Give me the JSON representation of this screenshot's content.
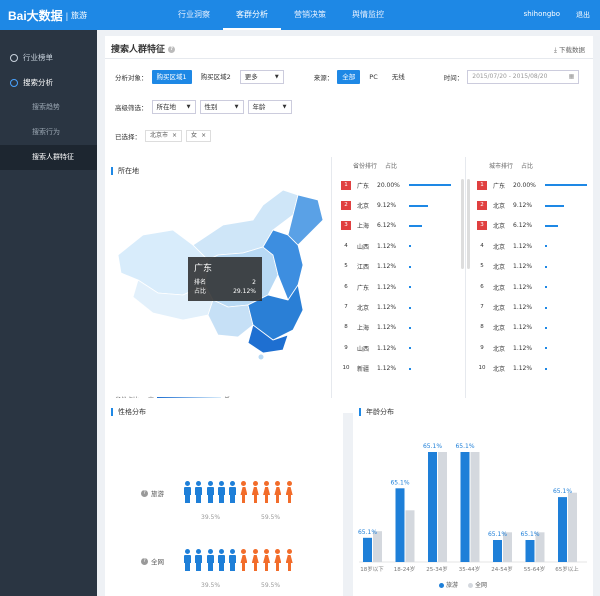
{
  "topbar": {
    "logo_text": "Bai大数据",
    "logo_sep": "|",
    "logo_sub": "旅游",
    "nav": [
      "行业洞察",
      "客群分析",
      "营销决策",
      "舆情监控"
    ],
    "active_nav": 1,
    "user": "shihongbo",
    "logout": "退出"
  },
  "sidebar": {
    "items": [
      {
        "label": "行业榜单",
        "icon": "medal-icon"
      },
      {
        "label": "搜索分析",
        "icon": "search-circle-icon"
      }
    ],
    "subitems": [
      "搜索趋势",
      "搜索行为",
      "搜索人群特征"
    ]
  },
  "header": {
    "title": "搜索人群特征",
    "help": "?",
    "download": "下载数据",
    "filters": {
      "target_label": "分析对象：",
      "target_options": [
        "购买区域1",
        "购买区域2"
      ],
      "more": "更多",
      "source_label": "来源：",
      "source_options": [
        "全部",
        "PC",
        "无线"
      ],
      "time_label": "时间：",
      "time_value": "2015/07/20 - 2015/08/20",
      "adv_label": "高级筛选：",
      "adv_selects": [
        "所在地",
        "性别",
        "年龄"
      ],
      "selected_label": "已选择：",
      "selected_tags": [
        "北京市",
        "女"
      ],
      "tag_close": "×"
    }
  },
  "location": {
    "title": "所在地",
    "province_header": [
      "省份排行",
      "占比"
    ],
    "city_header": [
      "城市排行",
      "占比"
    ],
    "provinces": [
      {
        "rank": "1",
        "name": "广东",
        "pct": "20.00%",
        "value": 20.0
      },
      {
        "rank": "2",
        "name": "北京",
        "pct": "9.12%",
        "value": 9.12
      },
      {
        "rank": "3",
        "name": "上海",
        "pct": "6.12%",
        "value": 6.12
      },
      {
        "rank": "4",
        "name": "山西",
        "pct": "1.12%",
        "value": 1.12
      },
      {
        "rank": "5",
        "name": "江西",
        "pct": "1.12%",
        "value": 1.12
      },
      {
        "rank": "6",
        "name": "广东",
        "pct": "1.12%",
        "value": 1.12
      },
      {
        "rank": "7",
        "name": "北京",
        "pct": "1.12%",
        "value": 1.12
      },
      {
        "rank": "8",
        "name": "上海",
        "pct": "1.12%",
        "value": 1.12
      },
      {
        "rank": "9",
        "name": "山西",
        "pct": "1.12%",
        "value": 1.12
      },
      {
        "rank": "10",
        "name": "新疆",
        "pct": "1.12%",
        "value": 1.12
      }
    ],
    "cities": [
      {
        "rank": "1",
        "name": "广东",
        "pct": "20.00%",
        "value": 20.0
      },
      {
        "rank": "2",
        "name": "北京",
        "pct": "9.12%",
        "value": 9.12
      },
      {
        "rank": "3",
        "name": "北京",
        "pct": "6.12%",
        "value": 6.12
      },
      {
        "rank": "4",
        "name": "北京",
        "pct": "1.12%",
        "value": 1.12
      },
      {
        "rank": "5",
        "name": "北京",
        "pct": "1.12%",
        "value": 1.12
      },
      {
        "rank": "6",
        "name": "北京",
        "pct": "1.12%",
        "value": 1.12
      },
      {
        "rank": "7",
        "name": "北京",
        "pct": "1.12%",
        "value": 1.12
      },
      {
        "rank": "8",
        "name": "北京",
        "pct": "1.12%",
        "value": 1.12
      },
      {
        "rank": "9",
        "name": "北京",
        "pct": "1.12%",
        "value": 1.12
      },
      {
        "rank": "10",
        "name": "北京",
        "pct": "1.12%",
        "value": 1.12
      }
    ],
    "tooltip": {
      "title": "广东",
      "rank_label": "排名",
      "rank_value": "2",
      "pct_label": "占比",
      "pct_value": "29.12%"
    },
    "legend_label": "省份占比：",
    "legend_high": "高",
    "legend_low": "低",
    "colors": {
      "high": "#1e6fd1",
      "low": "#d8ecfb"
    }
  },
  "gender": {
    "title": "性格分布",
    "rows": [
      {
        "label": "旅游",
        "male_pct": "39.5%",
        "female_pct": "59.5%"
      },
      {
        "label": "全网",
        "male_pct": "39.5%",
        "female_pct": "59.5%"
      }
    ],
    "help": "?",
    "colors": {
      "male": "#1e7fd8",
      "female": "#f26c2a"
    }
  },
  "chart_data": {
    "type": "bar",
    "title": "年龄分布",
    "categories": [
      "18岁以下",
      "18-24岁",
      "25-34岁",
      "35-44岁",
      "24-54岁",
      "55-64岁",
      "65岁以上"
    ],
    "series": [
      {
        "name": "旅游",
        "values": [
          65.1,
          65.1,
          65.1,
          65.1,
          65.1,
          65.1,
          65.1
        ],
        "heights": [
          0.22,
          0.67,
          1.0,
          1.0,
          0.2,
          0.2,
          0.59
        ],
        "color": "#1e7fd8"
      },
      {
        "name": "全网",
        "values": [
          null,
          null,
          null,
          null,
          null,
          null,
          null
        ],
        "heights": [
          0.28,
          0.47,
          1.0,
          1.0,
          0.27,
          0.27,
          0.63
        ],
        "color": "#d4d8de"
      }
    ],
    "data_labels": [
      "65.1%",
      "65.1%",
      "65.1%",
      "65.1%",
      "65.1%",
      "65.1%",
      "65.1%"
    ],
    "legend": [
      "旅游",
      "全网"
    ]
  }
}
